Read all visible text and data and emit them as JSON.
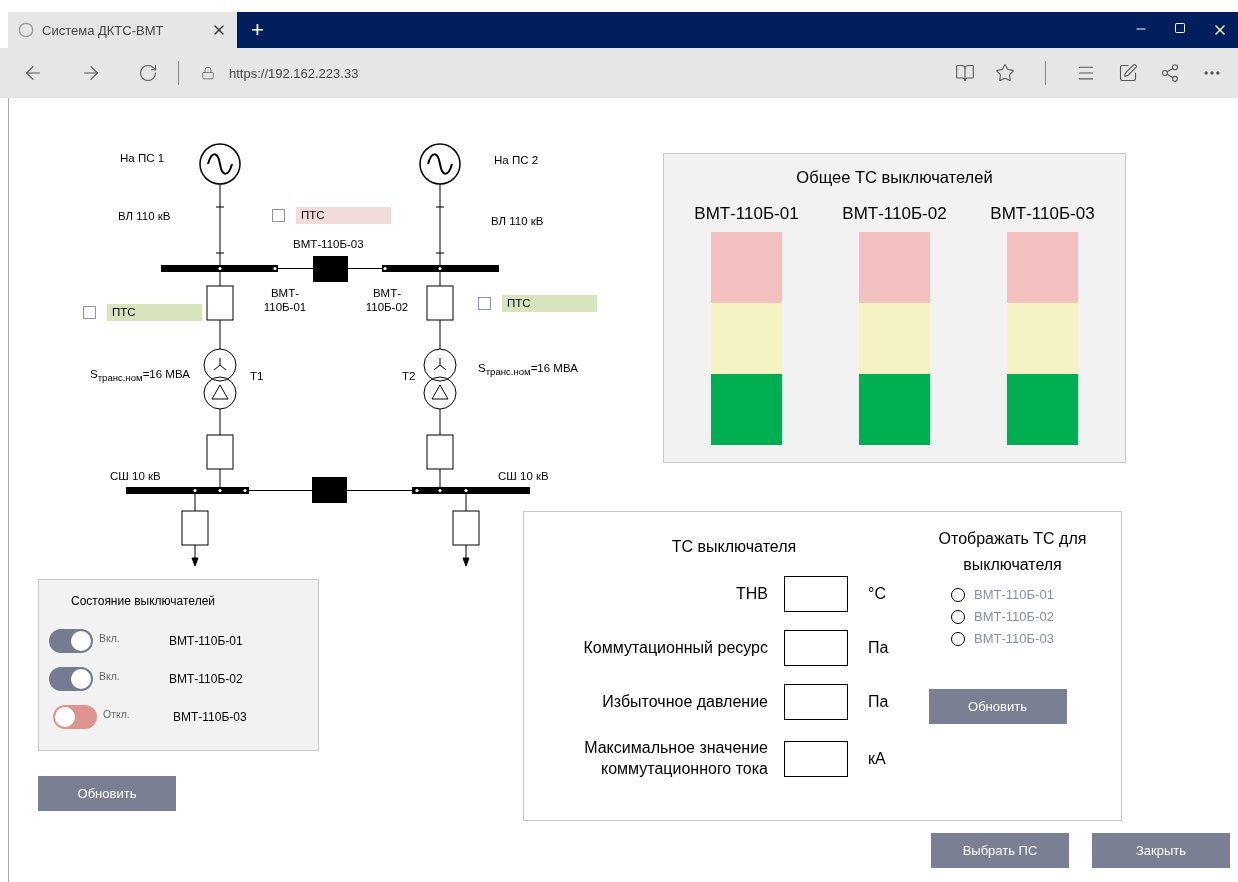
{
  "browser": {
    "tab_title": "Система ДКТС-ВМТ",
    "new_tab": "+",
    "url": "https://192.162.223.33"
  },
  "diagram": {
    "source_labels": [
      "На ПС 1",
      "На ПС 2"
    ],
    "line_labels": [
      "ВЛ 110 кВ",
      "ВЛ 110 кВ"
    ],
    "sectional_breaker": "ВМТ-110Б-03",
    "breaker_labels": [
      "ВМТ-\n110Б-01",
      "ВМТ-\n110Б-02"
    ],
    "power_labels": [
      "S$_{транс.ном}$=16 МВА",
      "S$_{транс.ном}$=16 МВА"
    ],
    "transformer_labels": [
      "Т1",
      "Т2"
    ],
    "bus_labels": [
      "СШ 10 кВ",
      "СШ 10 кВ"
    ],
    "pts": [
      {
        "label": "ПТС",
        "checked": false,
        "color": "#f2dcdb"
      },
      {
        "label": "ПТС",
        "checked": false,
        "color": "#d7e4bd"
      },
      {
        "label": "ПТС",
        "checked": false,
        "color": "#d7e4bd"
      }
    ]
  },
  "overview": {
    "title": "Общее ТС выключателей",
    "columns": [
      "ВМТ-110Б-01",
      "ВМТ-110Б-02",
      "ВМТ-110Б-03"
    ]
  },
  "switch_states": {
    "title": "Состояние выключателей",
    "items": [
      {
        "on": true,
        "state_label": "Вкл.",
        "name": "ВМТ-110Б-01"
      },
      {
        "on": true,
        "state_label": "Вкл.",
        "name": "ВМТ-110Б-02"
      },
      {
        "on": false,
        "state_label": "Откл.",
        "name": "ВМТ-110Б-03"
      }
    ],
    "button": "Обновить"
  },
  "indicators": {
    "title": "ТС выключателя",
    "rows": [
      {
        "label": "ТНВ",
        "unit": "°C"
      },
      {
        "label": "Коммутационный ресурс",
        "unit": "Па"
      },
      {
        "label": "Избыточное давление",
        "unit": "Па"
      },
      {
        "label": "Максимальное значение коммутационного тока",
        "unit": "кА"
      }
    ],
    "selector": {
      "title": "Отображать ТС для выключателя",
      "options": [
        {
          "label": "ВМТ-110Б-01",
          "selected": false
        },
        {
          "label": "ВМТ-110Б-02",
          "selected": false
        },
        {
          "label": "ВМТ-110Б-03",
          "selected": false
        }
      ],
      "button": "Обновить"
    }
  },
  "footer_buttons": [
    "Выбрать ПС",
    "Закрыть"
  ]
}
